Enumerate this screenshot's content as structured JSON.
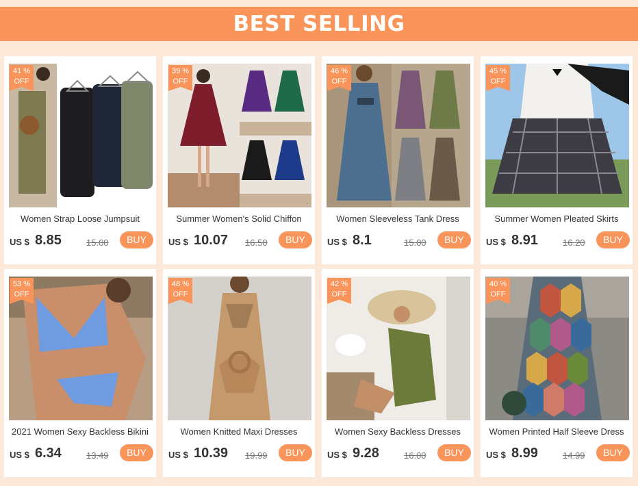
{
  "banner": {
    "title": "BEST SELLING"
  },
  "products": [
    {
      "name": "Women Strap Loose Jumpsuit",
      "discount_num": "41 %",
      "discount_label": "OFF",
      "currency": "US $",
      "price": "8.85",
      "old_price": "15.00",
      "buy_label": "BUY"
    },
    {
      "name": "Summer Women's Solid Chiffon",
      "discount_num": "39 %",
      "discount_label": "OFF",
      "currency": "US $",
      "price": "10.07",
      "old_price": "16.50",
      "buy_label": "BUY"
    },
    {
      "name": "Women Sleeveless Tank Dress",
      "discount_num": "46 %",
      "discount_label": "OFF",
      "currency": "US $",
      "price": "8.1",
      "old_price": "15.00",
      "buy_label": "BUY"
    },
    {
      "name": "Summer Women Pleated Skirts",
      "discount_num": "45 %",
      "discount_label": "OFF",
      "currency": "US $",
      "price": "8.91",
      "old_price": "16.20",
      "buy_label": "BUY"
    },
    {
      "name": "2021 Women Sexy Backless Bikini",
      "discount_num": "53 %",
      "discount_label": "OFF",
      "currency": "US $",
      "price": "6.34",
      "old_price": "13.49",
      "buy_label": "BUY"
    },
    {
      "name": "Women Knitted Maxi Dresses",
      "discount_num": "48 %",
      "discount_label": "OFF",
      "currency": "US $",
      "price": "10.39",
      "old_price": "19.99",
      "buy_label": "BUY"
    },
    {
      "name": "Women Sexy Backless Dresses",
      "discount_num": "42 %",
      "discount_label": "OFF",
      "currency": "US $",
      "price": "9.28",
      "old_price": "16.00",
      "buy_label": "BUY"
    },
    {
      "name": "Women Printed Half Sleeve Dress",
      "discount_num": "40 %",
      "discount_label": "OFF",
      "currency": "US $",
      "price": "8.99",
      "old_price": "14.99",
      "buy_label": "BUY"
    }
  ],
  "colors": {
    "accent": "#f9955a",
    "background": "#fde9da",
    "card": "#ffffff",
    "text": "#333333"
  }
}
